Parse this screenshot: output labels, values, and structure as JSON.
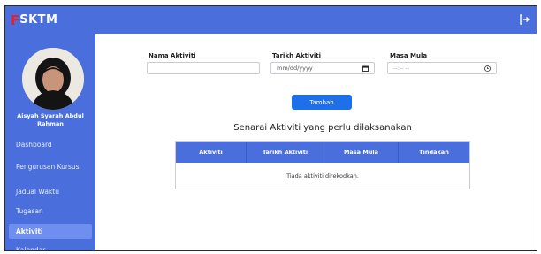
{
  "brand": {
    "logo_first": "F",
    "logo_rest": "SKTM"
  },
  "user": {
    "name": "Aisyah Syarah Abdul Rahman"
  },
  "sidebar": {
    "items": [
      {
        "label": "Dashboard",
        "active": false
      },
      {
        "label": "Pengurusan Kursus",
        "active": false
      },
      {
        "label": "Jadual Waktu",
        "active": false
      },
      {
        "label": "Tugasan",
        "active": false
      },
      {
        "label": "Aktiviti",
        "active": true
      },
      {
        "label": "Kalendar",
        "active": false
      }
    ]
  },
  "form": {
    "nama_label": "Nama Aktiviti",
    "nama_value": "",
    "tarikh_label": "Tarikh Aktiviti",
    "tarikh_placeholder": "mm/dd/yyyy",
    "masa_label": "Masa Mula",
    "masa_placeholder": "--:-- --",
    "add_label": "Tambah"
  },
  "table": {
    "title": "Senarai Aktiviti yang perlu dilaksanakan",
    "headers": [
      "Aktiviti",
      "Tarikh Aktiviti",
      "Masa Mula",
      "Tindakan"
    ],
    "empty_text": "Tiada aktiviti direkodkan."
  },
  "icons": {
    "calendar": "calendar-icon",
    "clock": "clock-icon",
    "logout": "logout-icon"
  },
  "colors": {
    "primary": "#4a6fdc",
    "button": "#1e6fe8",
    "active_nav": "#6e8ef0",
    "logo_red": "#e0242f"
  }
}
